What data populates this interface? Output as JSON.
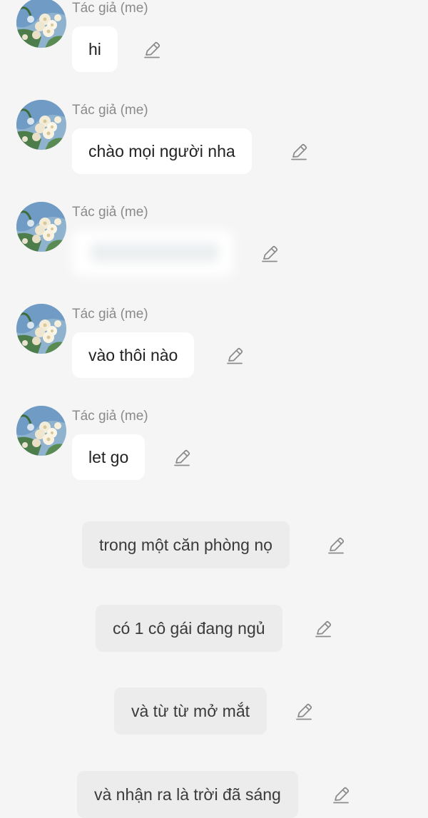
{
  "author_label": "Tác giả (me)",
  "icons": {
    "edit": "pencil-icon",
    "avatar": "flower-avatar"
  },
  "colors": {
    "background": "#f5f5f5",
    "bubble": "#ffffff",
    "narration_bubble": "#ececec",
    "author_text": "#8a8a8a",
    "icon": "#9a9a9a"
  },
  "messages": [
    {
      "author": "Tác giả (me)",
      "text": "hi"
    },
    {
      "author": "Tác giả (me)",
      "text": "chào mọi người nha"
    },
    {
      "author": "Tác giả (me)",
      "text": "",
      "blurred": true
    },
    {
      "author": "Tác giả (me)",
      "text": "vào thôi nào"
    },
    {
      "author": "Tác giả (me)",
      "text": "let go"
    }
  ],
  "narration": [
    {
      "text": "trong một căn phòng nọ"
    },
    {
      "text": "có 1 cô gái đang ngủ"
    },
    {
      "text": "và từ từ mở mắt"
    },
    {
      "text": "và nhận ra là trời đã sáng"
    }
  ]
}
